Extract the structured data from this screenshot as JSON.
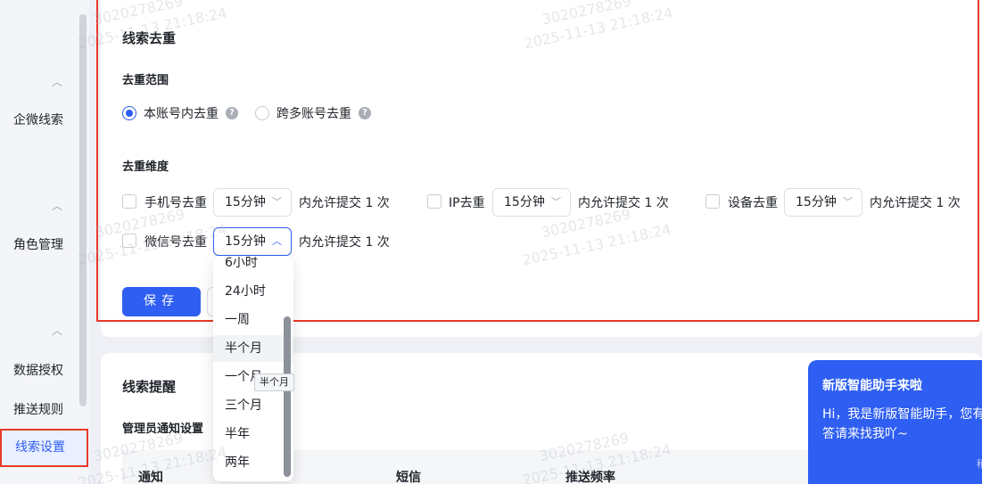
{
  "sidebar": {
    "items": [
      {
        "label": "企微线索"
      },
      {
        "label": "角色管理"
      },
      {
        "label": "数据授权"
      },
      {
        "label": "推送规则"
      },
      {
        "label": "线索设置"
      }
    ]
  },
  "dedupe": {
    "title": "线索去重",
    "scope_title": "去重范围",
    "scope_options": [
      "本账号内去重",
      "跨多账号去重"
    ],
    "dimension_title": "去重维度",
    "rows": [
      {
        "label": "手机号去重",
        "value": "15分钟",
        "suffix": "内允许提交 1 次"
      },
      {
        "label": "IP去重",
        "value": "15分钟",
        "suffix": "内允许提交 1 次"
      },
      {
        "label": "设备去重",
        "value": "15分钟",
        "suffix": "内允许提交 1 次"
      },
      {
        "label": "微信号去重",
        "value": "15分钟",
        "suffix": "内允许提交 1 次"
      }
    ],
    "save_label": "保存"
  },
  "dropdown": {
    "options": [
      "6小时",
      "24小时",
      "一周",
      "半个月",
      "一个月",
      "三个月",
      "半年",
      "两年"
    ],
    "hovered": "半个月",
    "tooltip": "半个月"
  },
  "reminder": {
    "title": "线索提醒",
    "admin_title": "管理员通知设置",
    "columns": [
      "通知",
      "短信",
      "推送频率"
    ]
  },
  "assistant": {
    "title": "新版智能助手来啦",
    "body": "Hi，我是新版智能助手，您有答请来找我吖~",
    "tail": "稍"
  },
  "watermark": {
    "id": "3020278269",
    "time": "2025-11-13 21:18:24"
  },
  "colors": {
    "accent": "#2f5ef2",
    "highlight": "#e8392b"
  }
}
